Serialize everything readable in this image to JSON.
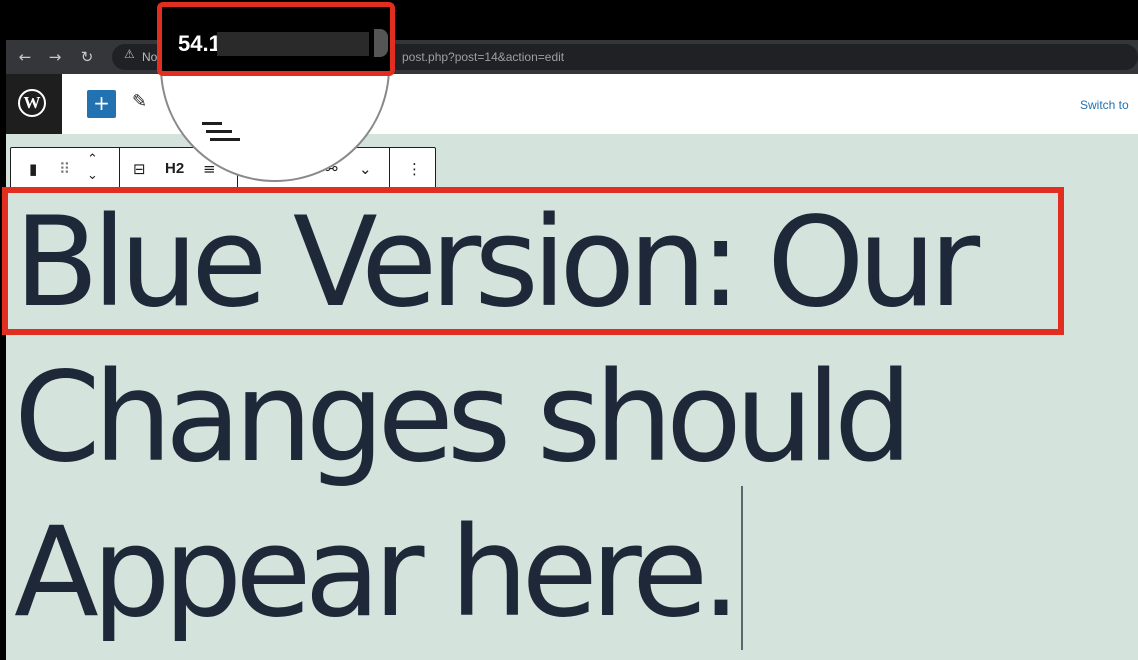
{
  "browser": {
    "back_icon": "arrow-left-icon",
    "forward_icon": "arrow-right-icon",
    "reload_icon": "reload-icon",
    "security_label": "No",
    "url_path": "post.php?post=14&action=edit"
  },
  "ip_overlay": {
    "visible_text": "54.1"
  },
  "wp_toolbar": {
    "logo_text": "W",
    "add_block_label": "+",
    "switch_label": "Switch to"
  },
  "block_toolbar": {
    "heading_level": "H2"
  },
  "heading": {
    "text": "Blue Version: Our Changes should Appear here."
  },
  "colors": {
    "highlight": "#e12e20",
    "canvas": "#d5e3dd",
    "accent": "#2271b1",
    "text": "#1e2838"
  }
}
